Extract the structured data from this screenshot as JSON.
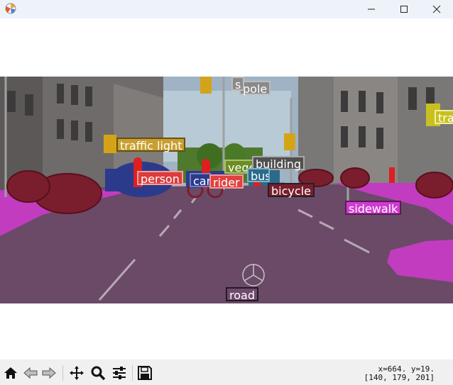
{
  "window": {
    "icons": {
      "app": "matplotlib-icon",
      "minimize": "minimize-icon",
      "maximize": "maximize-icon",
      "close": "close-icon"
    }
  },
  "figure": {
    "labels": [
      {
        "text": "pole",
        "color": "#808080"
      },
      {
        "text": "s",
        "color": "#808080"
      },
      {
        "text": "traffic light",
        "color": "#c8a030"
      },
      {
        "text": "vegetation",
        "color": "#6b8e23"
      },
      {
        "text": "building",
        "color": "#505050"
      },
      {
        "text": "person",
        "color": "#dc3c3c"
      },
      {
        "text": "car",
        "color": "#2c3a8c"
      },
      {
        "text": "rider",
        "color": "#e04040"
      },
      {
        "text": "bus",
        "color": "#2a6a8a"
      },
      {
        "text": "bicycle",
        "color": "#7a1e2e"
      },
      {
        "text": "sidewalk",
        "color": "#d03cd0"
      },
      {
        "text": "road",
        "color": "#704a6e"
      },
      {
        "text": "tra",
        "color": "#c8c020"
      }
    ]
  },
  "toolbar": {
    "buttons": [
      {
        "name": "home-icon"
      },
      {
        "name": "back-arrow-icon"
      },
      {
        "name": "forward-arrow-icon"
      },
      {
        "name": "pan-icon"
      },
      {
        "name": "zoom-icon"
      },
      {
        "name": "configure-subplots-icon"
      },
      {
        "name": "save-icon"
      }
    ],
    "coords_line1": "x=664. y=19.",
    "coords_line2": "[140, 179, 201]"
  }
}
